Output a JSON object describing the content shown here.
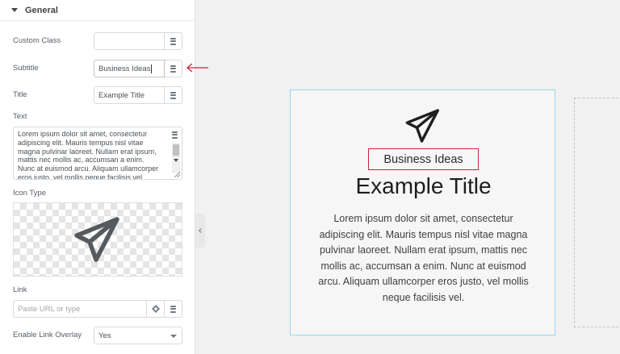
{
  "panel": {
    "section_title": "General",
    "custom_class": {
      "label": "Custom Class",
      "value": ""
    },
    "subtitle": {
      "label": "Subtitle",
      "value": "Business Ideas"
    },
    "title": {
      "label": "Title",
      "value": "Example Title"
    },
    "text": {
      "label": "Text",
      "value": "Lorem ipsum dolor sit amet, consectetur\nadipiscing elit. Mauris tempus nisl vitae\nmagna pulvinar laoreet. Nullam erat ipsum,\nmattis nec mollis ac, accumsan a enim.\nNunc at euismod arcu. Aliquam ullamcorper\neros justo, vel mollis neque facilisis vel."
    },
    "icon_type": {
      "label": "Icon Type",
      "icon": "paper-plane-icon"
    },
    "link": {
      "label": "Link",
      "placeholder": "Paste URL or type"
    },
    "enable_link_overlay": {
      "label": "Enable Link Overlay",
      "value": "Yes"
    }
  },
  "preview": {
    "icon": "paper-plane-icon",
    "subtitle": "Business Ideas",
    "title": "Example Title",
    "text": "Lorem ipsum dolor sit amet, consectetur adipiscing elit. Mauris tempus nisl vitae magna pulvinar laoreet. Nullam erat ipsum, mattis nec mollis ac, accumsan a enim. Nunc at euismod arcu. Aliquam ullamcorper eros justo, vel mollis neque facilisis vel."
  },
  "colors": {
    "annotation": "#d11f3f",
    "card_border": "#9ad7ee"
  }
}
